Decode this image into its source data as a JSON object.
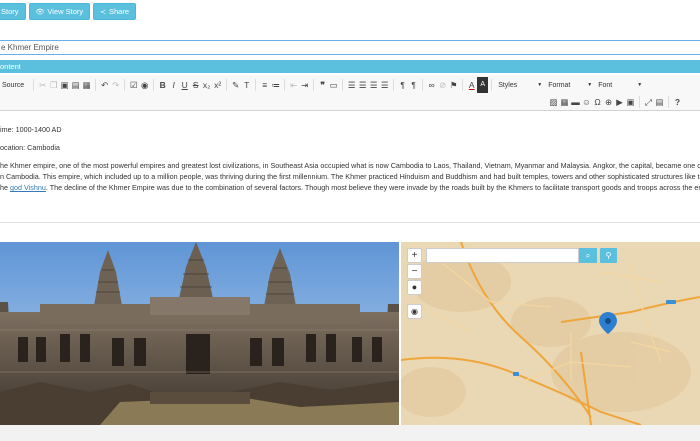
{
  "top_buttons": {
    "story_label": "Story",
    "view_story_label": "View Story",
    "share_label": "Share"
  },
  "title_field": {
    "value": "e Khmer Empire"
  },
  "content_section": {
    "label": "ontent"
  },
  "toolbar": {
    "source_label": "Source",
    "styles_label": "Styles",
    "format_label": "Format",
    "font_label": "Font"
  },
  "editor": {
    "time_line": "ime: 1000-1400 AD",
    "location_line": "ocation: Cambodia",
    "para_line1": "he Khmer empire, one of the most powerful empires and greatest lost civilizations, in Southeast Asia occupied what is now Cambodia to Laos, Thailand, Vietnam, Myanmar and Malaysia. Angkor, the capital, became one of the m",
    "para_line2": "n Cambodia. This empire, which included up to a million people, was thriving during the first millennium. The Khmer practiced Hinduism and Buddhism and had built temples, towers and other sophisticated structures like the Angk",
    "para_line3_prefix": "he ",
    "para_link": "god Vishnu",
    "para_line3_rest": ". The decline of the Khmer Empire was due to the combination of several factors. Though most believe they were invade by the roads built by the Khmers to facilitate transport goods and troops across the empire."
  },
  "map": {
    "zoom_in_label": "+",
    "zoom_out_label": "−",
    "search_placeholder": ""
  },
  "colors": {
    "accent": "#5bc0de",
    "link": "#337ab7",
    "map_pin": "#2f7fd0"
  },
  "icons": [
    "eye-icon",
    "share-icon",
    "cut-icon",
    "copy-icon",
    "paste-icon",
    "undo-icon",
    "redo-icon",
    "bold-icon",
    "italic-icon",
    "underline-icon",
    "link-icon",
    "image-icon",
    "table-icon",
    "search-icon",
    "map-pin-icon",
    "globe-icon",
    "target-icon",
    "help-icon"
  ]
}
